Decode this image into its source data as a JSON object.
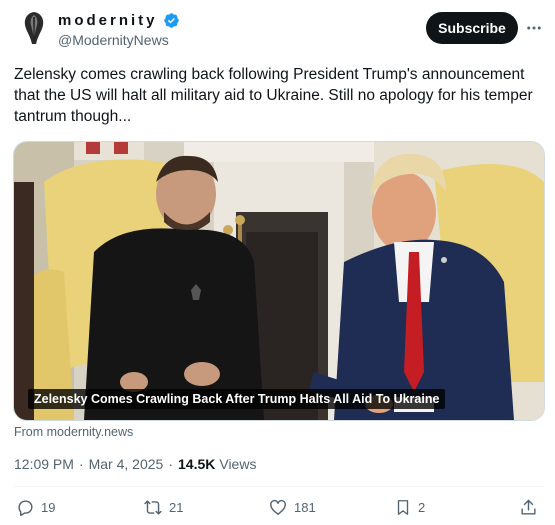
{
  "author": {
    "display_name": "modernity",
    "handle": "@ModernityNews",
    "verified": true,
    "verified_color": "#1d9bf0"
  },
  "header": {
    "subscribe_label": "Subscribe",
    "more_icon": "more-horizontal-icon"
  },
  "tweet": {
    "text": "Zelensky comes crawling back following President Trump's announcement that the US will halt all military aid to Ukraine. Still no apology for his temper tantrum though..."
  },
  "media": {
    "caption": "Zelensky Comes Crawling Back After Trump Halts All Aid To Ukraine",
    "source": "From modernity.news"
  },
  "meta": {
    "time": "12:09 PM",
    "separator": "·",
    "date": "Mar 4, 2025",
    "views_count": "14.5K",
    "views_label": "Views"
  },
  "actions": {
    "replies": "19",
    "reposts": "21",
    "likes": "181",
    "bookmarks": "2"
  },
  "colors": {
    "text_primary": "#0f1419",
    "text_secondary": "#536471",
    "subscribe_bg": "#0f1419",
    "divider": "#eff3f4"
  }
}
